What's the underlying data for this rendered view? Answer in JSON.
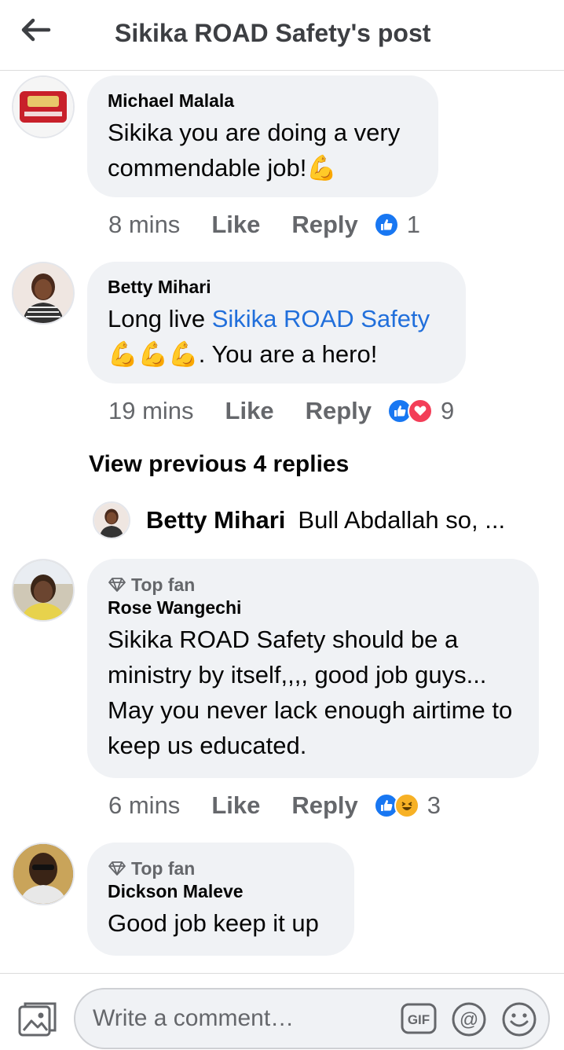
{
  "header": {
    "title": "Sikika ROAD Safety's post"
  },
  "comments": [
    {
      "name": "Michael Malala",
      "text": "Sikika you are doing a very commendable job!💪",
      "time": "8 mins",
      "like": "Like",
      "reply": "Reply",
      "reaction_count": "1"
    },
    {
      "name": "Betty Mihari",
      "text_prefix": "Long live ",
      "mention": "Sikika ROAD Safety",
      "text_suffix": "💪💪💪. You are a hero!",
      "time": "19 mins",
      "like": "Like",
      "reply": "Reply",
      "reaction_count": "9"
    },
    {
      "badge": "Top fan",
      "name": "Rose Wangechi",
      "text": "Sikika ROAD Safety should be a ministry by itself,,,, good job guys... May you never lack enough airtime to keep us educated.",
      "time": "6 mins",
      "like": "Like",
      "reply": "Reply",
      "reaction_count": "3"
    },
    {
      "badge": "Top fan",
      "name": "Dickson Maleve",
      "text": "Good job keep it up"
    }
  ],
  "view_previous": "View previous 4 replies",
  "reply_preview": {
    "name": "Betty Mihari",
    "text": "Bull Abdallah so, ..."
  },
  "composer": {
    "placeholder": "Write a comment…"
  },
  "colors": {
    "link": "#216fdb",
    "like_blue": "#1877f2",
    "love_red": "#f33e58",
    "bubble": "#f0f2f5"
  }
}
